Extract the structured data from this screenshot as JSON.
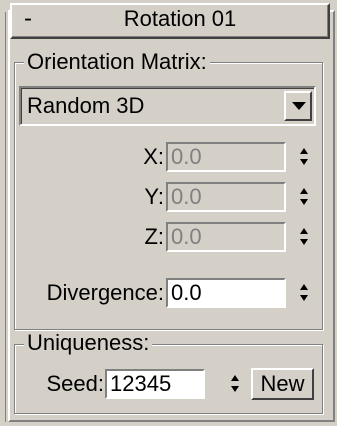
{
  "rollout": {
    "collapse_symbol": "-",
    "title": "Rotation 01"
  },
  "orientation": {
    "group_label": "Orientation Matrix:",
    "dropdown_value": "Random 3D",
    "x_label": "X:",
    "x_value": "0.0",
    "y_label": "Y:",
    "y_value": "0.0",
    "z_label": "Z:",
    "z_value": "0.0",
    "divergence_label": "Divergence:",
    "divergence_value": "0.0"
  },
  "uniqueness": {
    "group_label": "Uniqueness:",
    "seed_label": "Seed:",
    "seed_value": "12345",
    "new_label": "New"
  },
  "icons": {
    "dropdown": "chevron-down-icon",
    "spinner": "spinner-arrows-icon"
  }
}
